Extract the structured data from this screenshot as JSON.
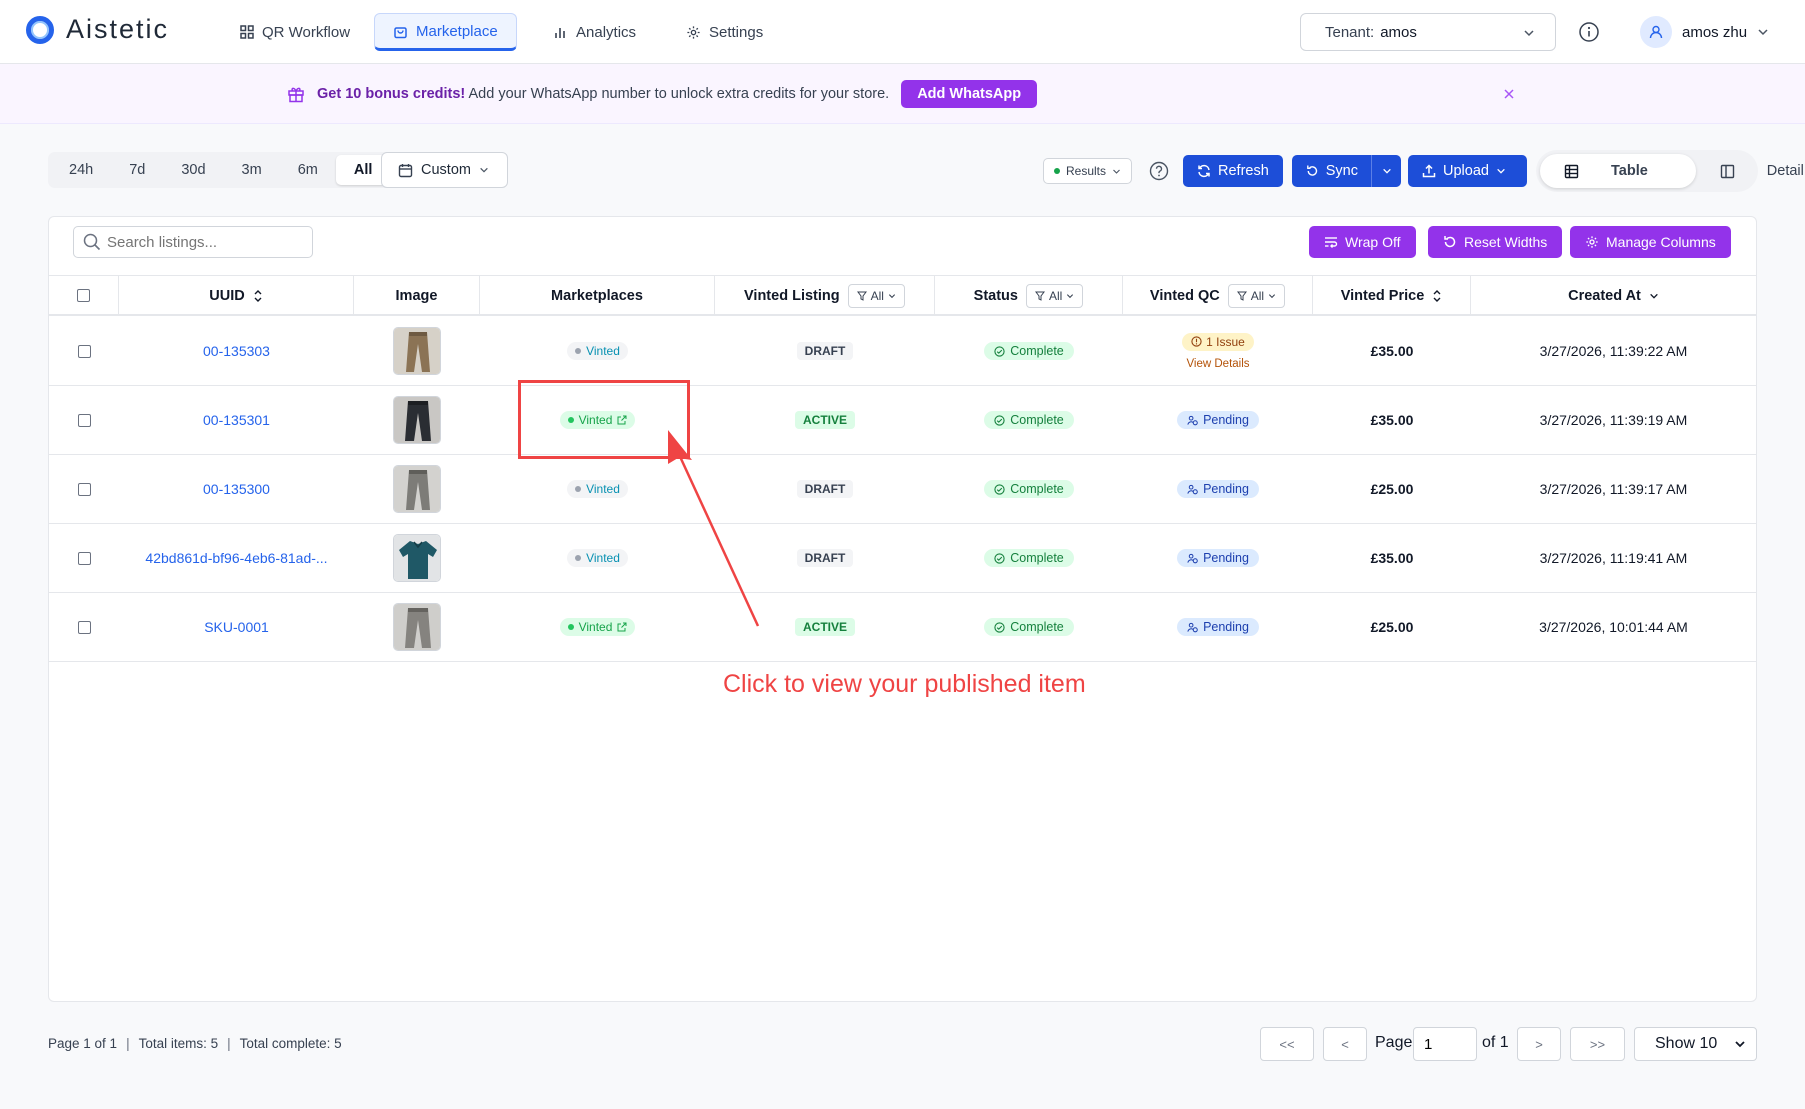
{
  "app": {
    "name": "Aistetic"
  },
  "nav": {
    "tabs": [
      {
        "label": "QR Workflow",
        "icon": "grid-icon"
      },
      {
        "label": "Marketplace",
        "icon": "bag-icon"
      },
      {
        "label": "Analytics",
        "icon": "bar-chart-icon"
      },
      {
        "label": "Settings",
        "icon": "gear-icon"
      }
    ],
    "tenant_label": "Tenant:",
    "tenant_value": "amos",
    "user_name": "amos zhu"
  },
  "banner": {
    "bold": "Get 10 bonus credits!",
    "text": "Add your WhatsApp number to unlock extra credits for your store.",
    "button": "Add WhatsApp"
  },
  "toolbar": {
    "ranges": [
      "24h",
      "7d",
      "30d",
      "3m",
      "6m",
      "All"
    ],
    "selected_range": "All",
    "custom": "Custom",
    "results": "Results",
    "refresh": "Refresh",
    "sync": "Sync",
    "upload": "Upload",
    "view_table": "Table",
    "view_detail": "Detail"
  },
  "table_tools": {
    "search_placeholder": "Search listings...",
    "wrap": "Wrap Off",
    "reset": "Reset Widths",
    "manage": "Manage Columns"
  },
  "columns": {
    "uuid": "UUID",
    "image": "Image",
    "marketplaces": "Marketplaces",
    "vinted_listing": "Vinted Listing",
    "status": "Status",
    "vinted_qc": "Vinted QC",
    "vinted_price": "Vinted Price",
    "created_at": "Created At",
    "filter_all": "All"
  },
  "rows": [
    {
      "uuid": "00-135303",
      "marketplace": "Vinted",
      "listing": "DRAFT",
      "status": "Complete",
      "qc": "1 Issue",
      "qc_link": "View Details",
      "price": "£35.00",
      "created": "3/27/2026, 11:39:22 AM"
    },
    {
      "uuid": "00-135301",
      "marketplace": "Vinted",
      "listing": "ACTIVE",
      "status": "Complete",
      "qc": "Pending",
      "price": "£35.00",
      "created": "3/27/2026, 11:39:19 AM"
    },
    {
      "uuid": "00-135300",
      "marketplace": "Vinted",
      "listing": "DRAFT",
      "status": "Complete",
      "qc": "Pending",
      "price": "£25.00",
      "created": "3/27/2026, 11:39:17 AM"
    },
    {
      "uuid": "42bd861d-bf96-4eb6-81ad-...",
      "marketplace": "Vinted",
      "listing": "DRAFT",
      "status": "Complete",
      "qc": "Pending",
      "price": "£35.00",
      "created": "3/27/2026, 11:19:41 AM"
    },
    {
      "uuid": "SKU-0001",
      "marketplace": "Vinted",
      "listing": "ACTIVE",
      "status": "Complete",
      "qc": "Pending",
      "price": "£25.00",
      "created": "3/27/2026, 10:01:44 AM"
    }
  ],
  "annotation": {
    "text": "Click to view your published item"
  },
  "footer": {
    "page_info": "Page 1 of 1",
    "total_items": "Total items: 5",
    "total_complete": "Total complete: 5",
    "first": "<<",
    "prev": "<",
    "page_label": "Page",
    "page_value": "1",
    "of_label": "of 1",
    "next": ">",
    "last": ">>",
    "show": "Show 10"
  },
  "colors": {
    "primary_blue": "#1d4ed8",
    "accent_purple": "#9333ea",
    "annotation_red": "#ef4444"
  }
}
